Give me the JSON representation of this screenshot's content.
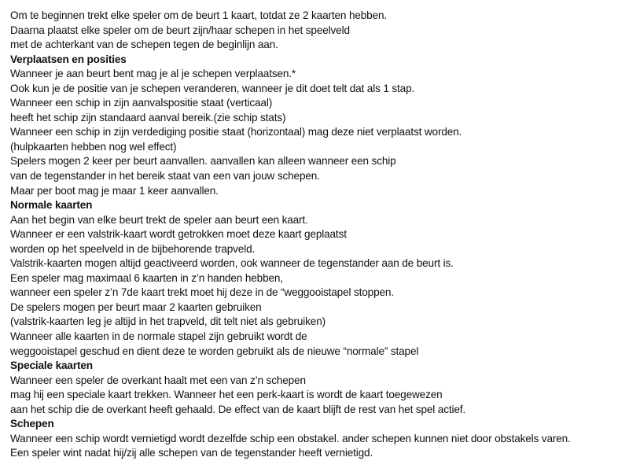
{
  "intro": [
    "Om te beginnen trekt elke speler om de beurt 1 kaart, totdat ze 2 kaarten hebben.",
    "Daarna plaatst elke speler om de beurt zijn/haar schepen in het speelveld",
    "met de achterkant van de schepen tegen de beginlijn aan."
  ],
  "verplaatsen": {
    "heading": "Verplaatsen en posities",
    "lines": [
      "Wanneer je aan beurt bent mag je al je schepen verplaatsen.*",
      "Ook kun je de positie van je schepen veranderen, wanneer je dit doet telt dat als 1 stap.",
      "Wanneer een schip in zijn aanvalspositie staat (verticaal)",
      "heeft het schip zijn standaard aanval bereik.(zie schip stats)",
      "Wanneer een schip in zijn verdediging positie staat (horizontaal) mag deze niet verplaatst worden.",
      "(hulpkaarten hebben nog wel effect)",
      "Spelers mogen 2 keer per beurt aanvallen. aanvallen kan alleen wanneer een schip",
      "van de tegenstander in het bereik staat van een van jouw schepen.",
      "Maar per boot mag je maar 1 keer aanvallen."
    ]
  },
  "normale": {
    "heading": "Normale kaarten",
    "lines": [
      "Aan het begin van elke beurt trekt de speler aan beurt een kaart.",
      "Wanneer er een valstrik-kaart wordt getrokken moet deze kaart geplaatst",
      "worden op het speelveld in de bijbehorende trapveld.",
      "Valstrik-kaarten mogen altijd geactiveerd worden, ook wanneer de tegenstander aan de beurt is.",
      "Een speler mag maximaal 6 kaarten in z’n handen hebben,",
      "wanneer een speler z’n 7de kaart trekt moet hij deze in de “weggooistapel stoppen.",
      "De spelers mogen per beurt maar 2 kaarten gebruiken",
      "(valstrik-kaarten leg je altijd in het trapveld, dit telt niet als gebruiken)",
      "Wanneer alle kaarten in de normale stapel zijn gebruikt wordt de",
      "weggooistapel geschud en dient deze te worden gebruikt als de nieuwe “normale” stapel"
    ]
  },
  "speciale": {
    "heading": "Speciale kaarten",
    "lines": [
      "Wanneer een speler de overkant haalt met een van z’n schepen",
      "mag hij een speciale kaart trekken. Wanneer het een perk-kaart is wordt de kaart toegewezen",
      "aan het schip die de overkant heeft gehaald. De effect van de kaart blijft de rest van het spel actief."
    ]
  },
  "schepen": {
    "heading": "Schepen",
    "lines": [
      "Wanneer een schip wordt vernietigd wordt dezelfde schip een obstakel. ander schepen kunnen niet door obstakels varen.",
      "Een speler wint nadat hij/zij alle schepen van de tegenstander heeft vernietigd."
    ]
  }
}
